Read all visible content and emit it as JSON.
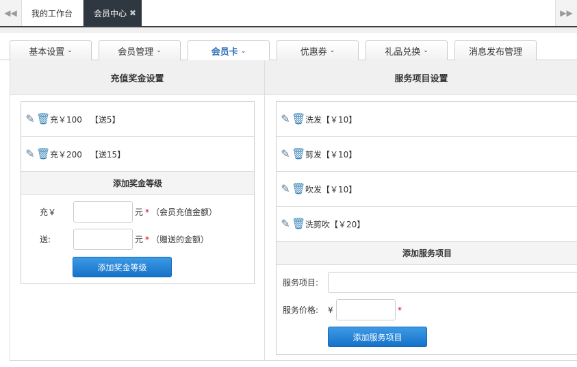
{
  "page_tabs": {
    "prev_icon": "double-left-arrow",
    "next_icon": "double-right-arrow",
    "items": [
      {
        "label": "我的工作台"
      },
      {
        "label": "会员中心",
        "close": "✖"
      }
    ]
  },
  "module_tabs": [
    {
      "label": "基本设置",
      "caret": "⌄"
    },
    {
      "label": "会员管理",
      "caret": "⌄"
    },
    {
      "label": "会员卡",
      "caret": "⌄"
    },
    {
      "label": "优惠券",
      "caret": "⌄"
    },
    {
      "label": "礼品兑换",
      "caret": "⌄"
    },
    {
      "label": "消息发布管理"
    }
  ],
  "active_tab": "会员卡",
  "recharge": {
    "title": "充值奖金设置",
    "items": [
      {
        "amount": "充￥100",
        "gift": "【送5】"
      },
      {
        "amount": "充￥200",
        "gift": "【送15】"
      }
    ],
    "add_title": "添加奖金等级",
    "fields": {
      "charge_label": "充￥",
      "charge_unit": "元",
      "charge_required": "*",
      "charge_hint": "（会员充值金额）",
      "gift_label": "送:",
      "gift_unit": "元",
      "gift_required": "*",
      "gift_hint": "（赠送的金额）"
    },
    "button": "添加奖金等级"
  },
  "service": {
    "title": "服务项目设置",
    "items": [
      {
        "text": "洗发【￥10】"
      },
      {
        "text": "剪发【￥10】"
      },
      {
        "text": "吹发【￥10】"
      },
      {
        "text": "洗剪吹【￥20】"
      }
    ],
    "add_title": "添加服务项目",
    "fields": {
      "name_label": "服务项目:",
      "price_label": "服务价格:",
      "currency": "¥",
      "price_required": "*"
    },
    "button": "添加服务项目"
  },
  "colors": {
    "accent": "#2a6db7",
    "button": "#1672c8",
    "active_tab_bg": "#2f3740",
    "required": "#d9001b"
  }
}
